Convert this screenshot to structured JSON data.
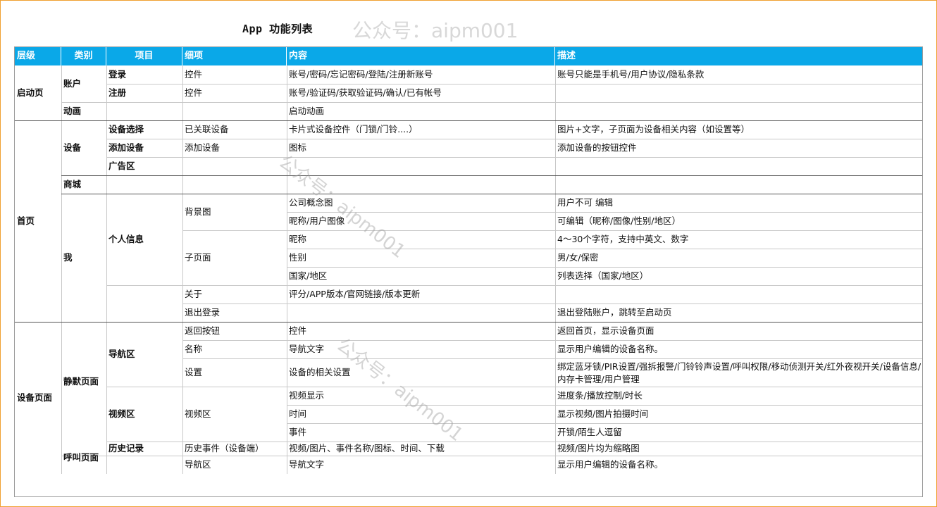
{
  "title": "App  功能列表",
  "watermark": "公众号：aipm001",
  "headers": [
    "层级",
    "类别",
    "项目",
    "细项",
    "内容",
    "描述"
  ],
  "levels": [
    "启动页",
    "首页",
    "设备页面"
  ],
  "categories": [
    "账户",
    "动画",
    "设备",
    "商城",
    "我",
    "静默页面",
    "呼叫页面"
  ],
  "items": [
    "登录",
    "注册",
    "设备选择",
    "添加设备",
    "广告区",
    "个人信息",
    "导航区",
    "视频区",
    "历史记录"
  ],
  "rows": [
    {
      "detail": "控件",
      "content": "账号/密码/忘记密码/登陆/注册新账号",
      "desc": "账号只能是手机号/用户协议/隐私条款"
    },
    {
      "detail": "控件",
      "content": "账号/验证码/获取验证码/确认/已有帐号",
      "desc": ""
    },
    {
      "detail": "",
      "content": "启动动画",
      "desc": ""
    },
    {
      "detail": "已关联设备",
      "content": "卡片式设备控件（门锁/门铃....）",
      "desc": "图片+文字，子页面为设备相关内容（如设置等）"
    },
    {
      "detail": "添加设备",
      "content": "图标",
      "desc": "添加设备的按钮控件"
    },
    {
      "detail": "",
      "content": "",
      "desc": ""
    },
    {
      "detail": "",
      "content": "",
      "desc": ""
    },
    {
      "detail": "背景图",
      "content": "公司概念图",
      "desc": "用户不可 编辑"
    },
    {
      "detail": "",
      "content": "昵称/用户图像",
      "desc": "可编辑（昵称/图像/性别/地区）"
    },
    {
      "detail": "子页面",
      "content": "昵称",
      "desc": "4～30个字符，支持中英文、数字"
    },
    {
      "detail": "",
      "content": "性别",
      "desc": "男/女/保密"
    },
    {
      "detail": "",
      "content": "国家/地区",
      "desc": "列表选择（国家/地区）"
    },
    {
      "detail": "关于",
      "content": "评分/APP版本/官网链接/版本更新",
      "desc": ""
    },
    {
      "detail": "退出登录",
      "content": "",
      "desc": "退出登陆账户，跳转至启动页"
    },
    {
      "detail": "返回按钮",
      "content": "控件",
      "desc": "返回首页，显示设备页面"
    },
    {
      "detail": "名称",
      "content": "导航文字",
      "desc": "显示用户编辑的设备名称。"
    },
    {
      "detail": "设置",
      "content": "设备的相关设置",
      "desc": "绑定蓝牙锁/PIR设置/强拆报警/门铃铃声设置/呼叫权限/移动侦测开关/红外夜视开关/设备信息/内存卡管理/用户管理"
    },
    {
      "detail": "视频区",
      "content": "视频显示",
      "desc": "进度条/播放控制/时长"
    },
    {
      "detail": "",
      "content": "时间",
      "desc": "显示视频/图片拍摄时间"
    },
    {
      "detail": "",
      "content": "事件",
      "desc": "开锁/陌生人逗留"
    },
    {
      "detail": "历史事件（设备端）",
      "content": "视频/图片、事件名称/图标、时间、下载",
      "desc": "视频/图片均为缩略图"
    },
    {
      "detail": "导航区",
      "content": "导航文字",
      "desc": "显示用户编辑的设备名称。"
    }
  ]
}
